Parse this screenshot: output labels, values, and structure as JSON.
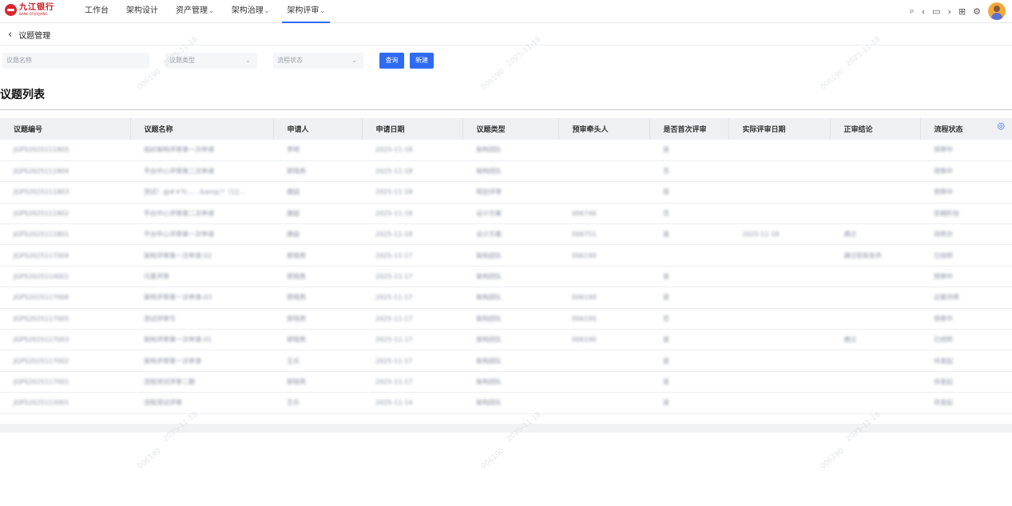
{
  "header": {
    "logo_cn": "九江银行",
    "logo_en": "BANK OF JIUJIANG",
    "nav": [
      {
        "label": "工作台",
        "dropdown": false,
        "active": false
      },
      {
        "label": "架构设计",
        "dropdown": false,
        "active": false
      },
      {
        "label": "资产管理",
        "dropdown": true,
        "active": false
      },
      {
        "label": "架构治理",
        "dropdown": true,
        "active": false
      },
      {
        "label": "架构评审",
        "dropdown": true,
        "active": true
      }
    ]
  },
  "breadcrumb": {
    "title": "议题管理"
  },
  "filters": {
    "name_placeholder": "议题名称",
    "type_placeholder": "议题类型",
    "status_placeholder": "流程状态",
    "query_label": "查询",
    "new_label": "新建"
  },
  "section": {
    "title": "议题列表"
  },
  "table": {
    "columns": [
      "议题编号",
      "议题名称",
      "申请人",
      "申请日期",
      "议题类型",
      "预审牵头人",
      "是否首次评审",
      "实际评审日期",
      "正审结论",
      "流程状态"
    ],
    "rows": [
      [
        "JGPS2025111805",
        "组织架构评审第一次申请",
        "李明",
        "2025-11-18",
        "架构团队",
        "",
        "是",
        "",
        "",
        "预审中"
      ],
      [
        "JGPS2025111804",
        "平台中心评审第二次申请",
        "郭晓燕",
        "2025-11-18",
        "架构团队",
        "",
        "否",
        "",
        "",
        "预审中"
      ],
      [
        "JGPS2025111803",
        "测试！@#￥%……&amp;*（12…",
        "唐超",
        "2025-11-18",
        "规划评审",
        "",
        "是",
        "",
        "",
        "预审中"
      ],
      [
        "JGPS2025111802",
        "平台中心评审第二次申请",
        "唐超",
        "2025-11-18",
        "设计方案",
        "006746",
        "否",
        "",
        "",
        "定稿阶段"
      ],
      [
        "JGPS2025111801",
        "平台中心评审第一次申请",
        "唐超",
        "2025-11-18",
        "设计方案",
        "006751",
        "是",
        "2025-11-18",
        "通过",
        "待转办"
      ],
      [
        "JGPS2025117004",
        "架构评审第一次申请-02",
        "郭晓燕",
        "2025-11-17",
        "架构团队",
        "006190",
        "",
        "",
        "通过但有条件",
        "已结转"
      ],
      [
        "JGPS2025114001",
        "元素评审",
        "郭晓燕",
        "2025-11-17",
        "架构团队",
        "",
        "是",
        "",
        "",
        "预审中"
      ],
      [
        "JGPS2025117006",
        "架构评审第一次申请-03",
        "郭晓燕",
        "2025-11-17",
        "架构团队",
        "006190",
        "是",
        "",
        "",
        "议案待审"
      ],
      [
        "JGPS2025117005",
        "测试评审号",
        "郭晓燕",
        "2025-11-17",
        "架构团队",
        "006190",
        "否",
        "",
        "",
        "预审中"
      ],
      [
        "JGPS2025117003",
        "架构评审第一次申请-01",
        "郭晓燕",
        "2025-11-17",
        "架构团队",
        "006190",
        "是",
        "",
        "通过",
        "已结转"
      ],
      [
        "JGPS2025117002",
        "架构评审第一次申请",
        "王乐",
        "2025-11-17",
        "架构团队",
        "",
        "是",
        "",
        "",
        "待发起"
      ],
      [
        "JGPS2025117001",
        "流程测试评审二期",
        "郭晓燕",
        "2025-11-17",
        "架构团队",
        "",
        "是",
        "",
        "",
        "待发起"
      ],
      [
        "JGPS2025113001",
        "流程测试评审",
        "王乐",
        "2025-11-14",
        "架构团队",
        "",
        "是",
        "",
        "",
        "待发起"
      ]
    ]
  },
  "watermark": {
    "texts": [
      "2025-11-18",
      "006190"
    ]
  },
  "colors": {
    "accent": "#2f6bf0",
    "brand": "#c8161d"
  }
}
